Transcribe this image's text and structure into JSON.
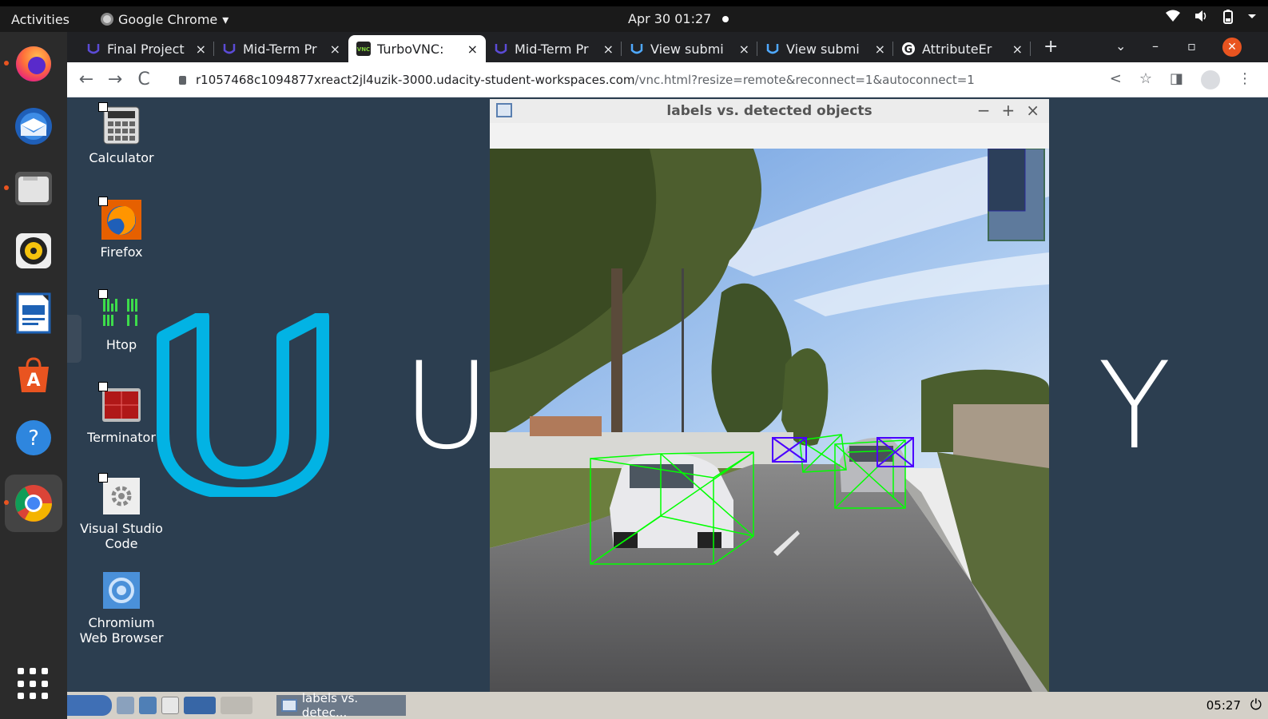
{
  "topbar": {
    "activities": "Activities",
    "app_name": "Google Chrome",
    "app_menu_arrow": "▾",
    "datetime": "Apr 30  01:27",
    "icons": [
      "wifi-icon",
      "volume-icon",
      "battery-icon",
      "system-menu-arrow-icon"
    ]
  },
  "dock": {
    "apps": [
      {
        "name": "firefox",
        "running": true
      },
      {
        "name": "thunderbird",
        "running": false
      },
      {
        "name": "files",
        "running": true
      },
      {
        "name": "rhythmbox",
        "running": false
      },
      {
        "name": "libreoffice-writer",
        "running": false
      },
      {
        "name": "ubuntu-software",
        "running": false
      },
      {
        "name": "help",
        "running": false
      },
      {
        "name": "chrome",
        "running": true
      }
    ]
  },
  "tabs": [
    {
      "label": "Final Project",
      "icon": "udacity",
      "active": false
    },
    {
      "label": "Mid-Term Pr",
      "icon": "udacity",
      "active": false
    },
    {
      "label": "TurboVNC: ",
      "icon": "vnc",
      "active": true
    },
    {
      "label": "Mid-Term Pr",
      "icon": "udacity",
      "active": false
    },
    {
      "label": "View submi",
      "icon": "udacity",
      "active": false
    },
    {
      "label": "View submi",
      "icon": "udacity",
      "active": false
    },
    {
      "label": "AttributeEr",
      "icon": "google",
      "active": false
    }
  ],
  "tabstrip": {
    "new_tab": "+",
    "close_glyph": "×",
    "tab_search": "⌄",
    "minimize": "–",
    "restore": "▫",
    "close": "✕"
  },
  "toolbar": {
    "back": "←",
    "forward": "→",
    "reload": "C",
    "url_host": "r1057468c1094877xreact2jl4uzik-3000.udacity-student-workspaces.com",
    "url_rest": "/vnc.html?resize=remote&reconnect=1&autoconnect=1",
    "share": "<",
    "star": "☆",
    "sidepanel": "◨",
    "more": "⋮"
  },
  "desktop": {
    "icons": [
      {
        "label": "Calculator",
        "icon": "calculator-icon"
      },
      {
        "label": "Firefox",
        "icon": "firefox-icon"
      },
      {
        "label": "Htop",
        "icon": "htop-icon"
      },
      {
        "label": "Terminator",
        "icon": "terminator-icon"
      },
      {
        "label": "Visual Studio\nCode",
        "icon": "vscode-icon"
      },
      {
        "label": "Chromium\nWeb Browser",
        "icon": "chromium-icon"
      }
    ],
    "brand_left": "U",
    "brand_right": "Y",
    "brand_color": "#02b3e4"
  },
  "cv_window": {
    "title": "labels vs. detected objects",
    "controls": [
      "−",
      "+",
      "×"
    ],
    "label_box_color": "#00ff00",
    "detection_box_color": "#4b00ff"
  },
  "panel": {
    "task_label": "labels vs. detec...",
    "time": "05:27",
    "power": "⏻"
  }
}
